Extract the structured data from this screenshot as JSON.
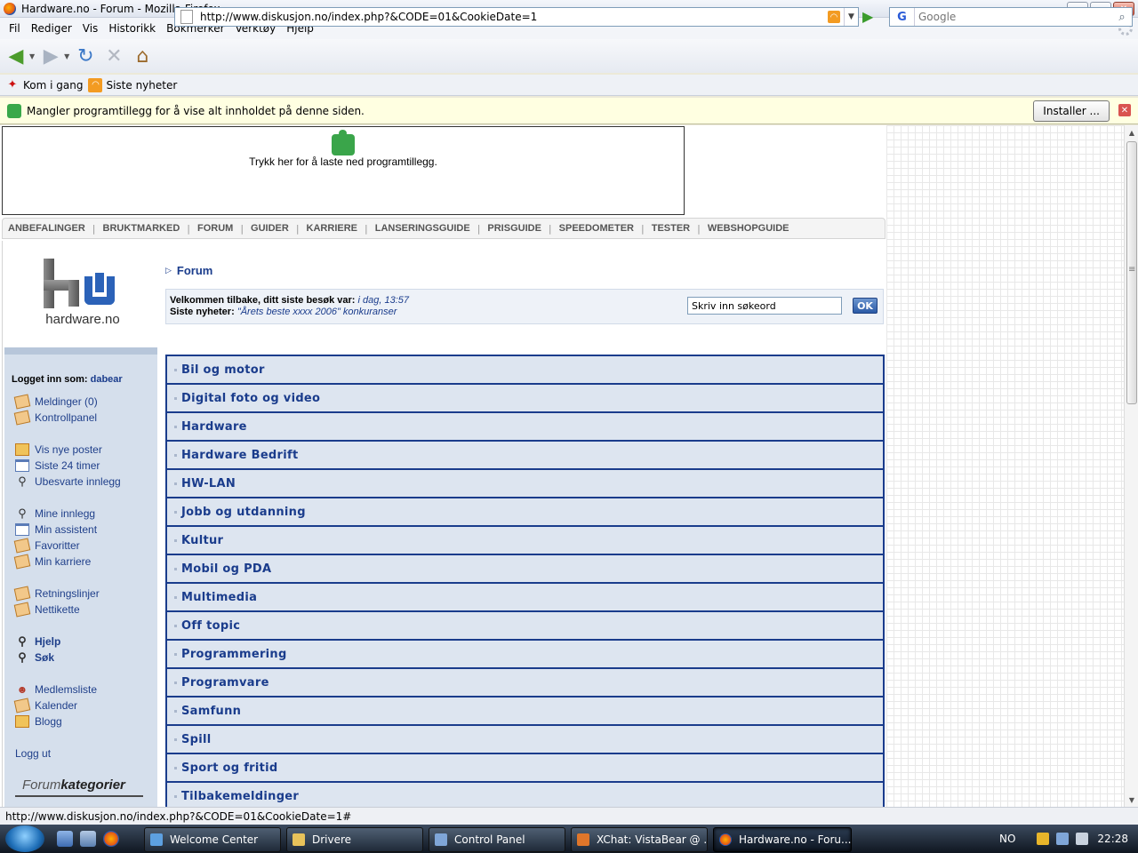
{
  "window": {
    "title": "Hardware.no - Forum - Mozilla Firefox"
  },
  "menu": [
    "Fil",
    "Rediger",
    "Vis",
    "Historikk",
    "Bokmerker",
    "Verktøy",
    "Hjelp"
  ],
  "nav": {
    "url": "http://www.diskusjon.no/index.php?&CODE=01&CookieDate=1",
    "search_placeholder": "Google",
    "search_engine_icon": "G"
  },
  "bookmarks": [
    {
      "label": "Kom i gang",
      "icon": "bookmark-star-icon"
    },
    {
      "label": "Siste nyheter",
      "icon": "rss-icon"
    }
  ],
  "notification": {
    "message": "Mangler programtillegg for å vise alt innholdet på denne siden.",
    "install_label": "Installer ..."
  },
  "plugin_box": {
    "text": "Trykk her for å laste ned programtillegg."
  },
  "site_nav": [
    "ANBEFALINGER",
    "BRUKTMARKED",
    "FORUM",
    "GUIDER",
    "KARRIERE",
    "LANSERINGSGUIDE",
    "PRISGUIDE",
    "SPEEDOMETER",
    "TESTER",
    "WEBSHOPGUIDE"
  ],
  "logo": {
    "name": "hardware.no"
  },
  "sidebar": {
    "logged_label": "Logget inn som:",
    "username": "dabear",
    "items": [
      {
        "label": "Meldinger (0)",
        "icon": "doc"
      },
      {
        "label": "Kontrollpanel",
        "icon": "doc"
      },
      {
        "label": "Vis nye poster",
        "icon": "env"
      },
      {
        "label": "Siste 24 timer",
        "icon": "cal"
      },
      {
        "label": "Ubesvarte innlegg",
        "icon": "mag"
      },
      {
        "label": "Mine innlegg",
        "icon": "mag"
      },
      {
        "label": "Min assistent",
        "icon": "cal"
      },
      {
        "label": "Favoritter",
        "icon": "doc"
      },
      {
        "label": "Min karriere",
        "icon": "doc"
      },
      {
        "label": "Retningslinjer",
        "icon": "doc"
      },
      {
        "label": "Nettikette",
        "icon": "doc"
      },
      {
        "label": "Hjelp",
        "icon": "mag"
      },
      {
        "label": "Søk",
        "icon": "mag"
      },
      {
        "label": "Medlemsliste",
        "icon": "ppl"
      },
      {
        "label": "Kalender",
        "icon": "doc"
      },
      {
        "label": "Blogg",
        "icon": "env"
      },
      {
        "label": "Logg ut",
        "icon": ""
      }
    ],
    "forumkategorier_a": "Forum",
    "forumkategorier_b": "kategorier"
  },
  "main": {
    "breadcrumb": "Forum",
    "welcome_label": "Velkommen tilbake, ditt siste besøk var:",
    "welcome_value": "i dag, 13:57",
    "news_label": "Siste nyheter:",
    "news_value": "\"Årets beste xxxx 2006\" konkuranser",
    "search_value": "Skriv inn søkeord",
    "ok_label": "OK",
    "categories": [
      "Bil og motor",
      "Digital foto og video",
      "Hardware",
      "Hardware Bedrift",
      "HW-LAN",
      "Jobb og utdanning",
      "Kultur",
      "Mobil og PDA",
      "Multimedia",
      "Off topic",
      "Programmering",
      "Programvare",
      "Samfunn",
      "Spill",
      "Sport og fritid",
      "Tilbakemeldinger"
    ]
  },
  "statusbar": {
    "text": "http://www.diskusjon.no/index.php?&CODE=01&CookieDate=1#"
  },
  "taskbar": {
    "tasks": [
      "Welcome Center",
      "Drivere",
      "Control Panel",
      "XChat: VistaBear @ ...",
      "Hardware.no - Foru..."
    ],
    "language": "NO",
    "clock": "22:28"
  }
}
